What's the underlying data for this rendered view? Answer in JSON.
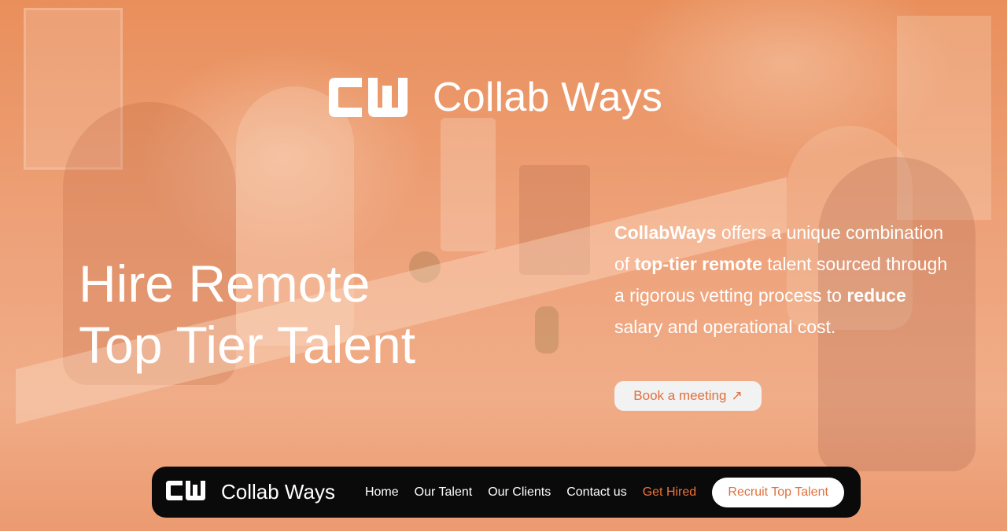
{
  "brand": {
    "logo_text": "CW",
    "name": "Collab Ways"
  },
  "hero": {
    "headline_line1": "Hire Remote",
    "headline_line2": "Top Tier Talent",
    "description_segments": [
      {
        "text": "CollabWays",
        "bold": true
      },
      {
        "text": " offers a unique combination of ",
        "bold": false
      },
      {
        "text": "top-tier remote",
        "bold": true
      },
      {
        "text": " talent sourced through a rigorous vetting process to ",
        "bold": false
      },
      {
        "text": "reduce",
        "bold": true
      },
      {
        "text": " salary and operational cost.",
        "bold": false
      }
    ],
    "cta_label": "Book a meeting",
    "cta_icon": "arrow-up-right-icon",
    "cta_glyph": "↗"
  },
  "nav": {
    "brand_name": "Collab Ways",
    "links": [
      {
        "label": "Home"
      },
      {
        "label": "Our Talent"
      },
      {
        "label": "Our Clients"
      },
      {
        "label": "Contact us"
      },
      {
        "label": "Get Hired"
      }
    ],
    "cta_label": "Recruit Top Talent"
  },
  "colors": {
    "accent": "#f0733a",
    "hero_overlay": "#eea27a",
    "nav_background": "#0a0a0a",
    "text_light": "#ffffff"
  }
}
